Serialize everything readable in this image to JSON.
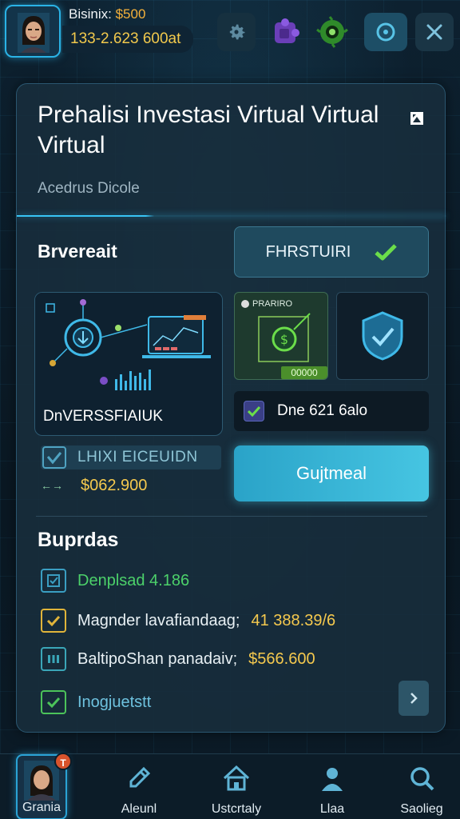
{
  "header": {
    "user_name": "Bisinix: ",
    "user_money": "$500",
    "balance": "133-2.623 600at",
    "icons": [
      "gear-icon",
      "puzzle-icon",
      "badge-icon",
      "circle-icon",
      "close-icon"
    ]
  },
  "card": {
    "title": "Prehalisi Investasi Virtual Virtual Virtual",
    "subtitle": "Acedrus Dicole",
    "section_label": "Brvereait",
    "pill_button": "FHRSTUIRI",
    "tile_big_label": "DnVERSSFIAIUK",
    "tile_mid_top": "PRARIRO",
    "tile_mid_tag": "00000",
    "check_row": "Dne 621 6alo",
    "stat_line": "LHIXI EICEUIDN",
    "price_arrow": "←→",
    "price": "$062.900",
    "primary_button": "Gujtmeal",
    "list_title": "Buprdas",
    "list_items": [
      {
        "text": "Denplsad 4.186",
        "value": ""
      },
      {
        "text": "Magnder lavafiandaag;",
        "value": "41 388.39/6"
      },
      {
        "text": "BaltipoShan panadaiv;",
        "value": "$566.600"
      },
      {
        "text": "Inogjuetstt",
        "value": ""
      }
    ]
  },
  "nav": {
    "items": [
      {
        "label": "Grania",
        "badge": "T"
      },
      {
        "label": "Aleunl"
      },
      {
        "label": "Ustcrtaly"
      },
      {
        "label": "Llaa"
      },
      {
        "label": "Saolieg"
      }
    ]
  },
  "colors": {
    "accent": "#2ab3e6",
    "gold": "#f5c94e",
    "green": "#4cd16a",
    "background": "#0b1a26"
  }
}
